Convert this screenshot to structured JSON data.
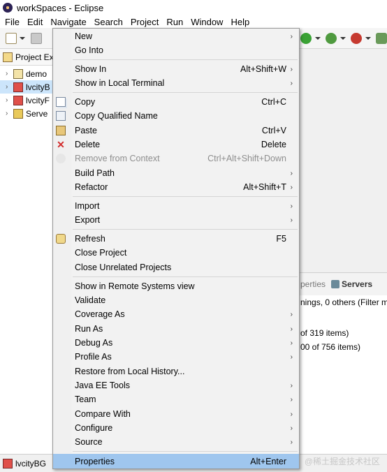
{
  "window": {
    "title": "workSpaces - Eclipse"
  },
  "menubar": [
    {
      "label": "File",
      "mnemonic": "F"
    },
    {
      "label": "Edit",
      "mnemonic": "E"
    },
    {
      "label": "Navigate",
      "mnemonic": "N"
    },
    {
      "label": "Search",
      "mnemonic": "a"
    },
    {
      "label": "Project",
      "mnemonic": "P"
    },
    {
      "label": "Run",
      "mnemonic": "R"
    },
    {
      "label": "Window",
      "mnemonic": "W"
    },
    {
      "label": "Help",
      "mnemonic": "H"
    }
  ],
  "explorer": {
    "tab_label": "Project Ex",
    "items": [
      {
        "label": "demo",
        "icon": "project-icon"
      },
      {
        "label": "lvcityB",
        "icon": "web-project-icon"
      },
      {
        "label": "lvcityF",
        "icon": "web-project-icon"
      },
      {
        "label": "Serve",
        "icon": "servers-folder-icon"
      }
    ]
  },
  "context_menu": {
    "items": [
      {
        "label": "New",
        "accel": "",
        "submenu": true
      },
      {
        "label": "Go Into",
        "accel": "",
        "submenu": false
      },
      {
        "label": "Show In",
        "accel": "Alt+Shift+W",
        "submenu": true
      },
      {
        "label": "Show in Local Terminal",
        "accel": "",
        "submenu": true
      },
      {
        "label": "Copy",
        "accel": "Ctrl+C",
        "submenu": false,
        "icon": "copy-icon"
      },
      {
        "label": "Copy Qualified Name",
        "accel": "",
        "submenu": false,
        "icon": "copy-qualified-name-icon"
      },
      {
        "label": "Paste",
        "accel": "Ctrl+V",
        "submenu": false,
        "icon": "paste-icon"
      },
      {
        "label": "Delete",
        "accel": "Delete",
        "submenu": false,
        "icon": "delete-icon"
      },
      {
        "label": "Remove from Context",
        "accel": "Ctrl+Alt+Shift+Down",
        "submenu": false,
        "icon": "remove-from-context-icon",
        "disabled": true
      },
      {
        "label": "Build Path",
        "accel": "",
        "submenu": true
      },
      {
        "label": "Refactor",
        "accel": "Alt+Shift+T",
        "submenu": true
      },
      {
        "label": "Import",
        "accel": "",
        "submenu": true
      },
      {
        "label": "Export",
        "accel": "",
        "submenu": true
      },
      {
        "label": "Refresh",
        "accel": "F5",
        "submenu": false,
        "icon": "refresh-icon"
      },
      {
        "label": "Close Project",
        "accel": "",
        "submenu": false
      },
      {
        "label": "Close Unrelated Projects",
        "accel": "",
        "submenu": false
      },
      {
        "label": "Show in Remote Systems view",
        "accel": "",
        "submenu": false
      },
      {
        "label": "Validate",
        "accel": "",
        "submenu": false
      },
      {
        "label": "Coverage As",
        "accel": "",
        "submenu": true
      },
      {
        "label": "Run As",
        "accel": "",
        "submenu": true
      },
      {
        "label": "Debug As",
        "accel": "",
        "submenu": true
      },
      {
        "label": "Profile As",
        "accel": "",
        "submenu": true
      },
      {
        "label": "Restore from Local History...",
        "accel": "",
        "submenu": false
      },
      {
        "label": "Java EE Tools",
        "accel": "",
        "submenu": true
      },
      {
        "label": "Team",
        "accel": "",
        "submenu": true
      },
      {
        "label": "Compare With",
        "accel": "",
        "submenu": true
      },
      {
        "label": "Configure",
        "accel": "",
        "submenu": true
      },
      {
        "label": "Source",
        "accel": "",
        "submenu": true
      },
      {
        "label": "Properties",
        "accel": "Alt+Enter",
        "submenu": false,
        "selected": true
      }
    ],
    "submenu_glyph": "›"
  },
  "right_pane": {
    "tab_partial": "perties",
    "servers_tab": "Servers",
    "lines": [
      "nings, 0 others (Filter m",
      "of 319 items)",
      "00 of 756 items)"
    ]
  },
  "statusbar": {
    "selected_label": "lvcityBG"
  },
  "watermark": "@稀土掘金技术社区",
  "colors": {
    "selection": "#9fc6ee",
    "menu_bg": "#f2f2f2",
    "disabled_text": "#8e8e8e"
  }
}
